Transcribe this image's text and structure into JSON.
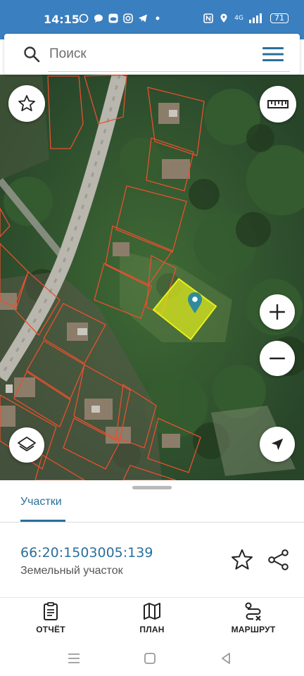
{
  "status_bar": {
    "time": "14:15",
    "app_icons": [
      "whatsapp-icon",
      "message-icon",
      "cloud-icon",
      "instagram-icon",
      "telegram-icon",
      "dot-icon"
    ],
    "right_icons": [
      "nfc-icon",
      "location-icon",
      "signal-icon"
    ],
    "network": "4G",
    "battery": "71"
  },
  "search": {
    "placeholder": "Поиск"
  },
  "map": {
    "buttons": [
      "favorite-star-icon",
      "ruler-icon",
      "zoom-in-icon",
      "zoom-out-icon",
      "layers-icon",
      "my-location-icon"
    ],
    "selected_parcel_color": "#e6f01a",
    "parcel_outline_color": "#e8502f",
    "marker_color": "#2f8a9a"
  },
  "sheet": {
    "tab_label": "Участки",
    "parcel": {
      "cadastral_number": "66:20:1503005:139",
      "type": "Земельный участок"
    }
  },
  "bottom_nav": {
    "items": [
      {
        "label": "ОТЧЁТ",
        "icon": "report-icon"
      },
      {
        "label": "ПЛАН",
        "icon": "map-plan-icon"
      },
      {
        "label": "МАРШРУТ",
        "icon": "route-icon"
      }
    ]
  },
  "colors": {
    "accent": "#2a6f9b",
    "status_bar": "#3a7fbf"
  }
}
